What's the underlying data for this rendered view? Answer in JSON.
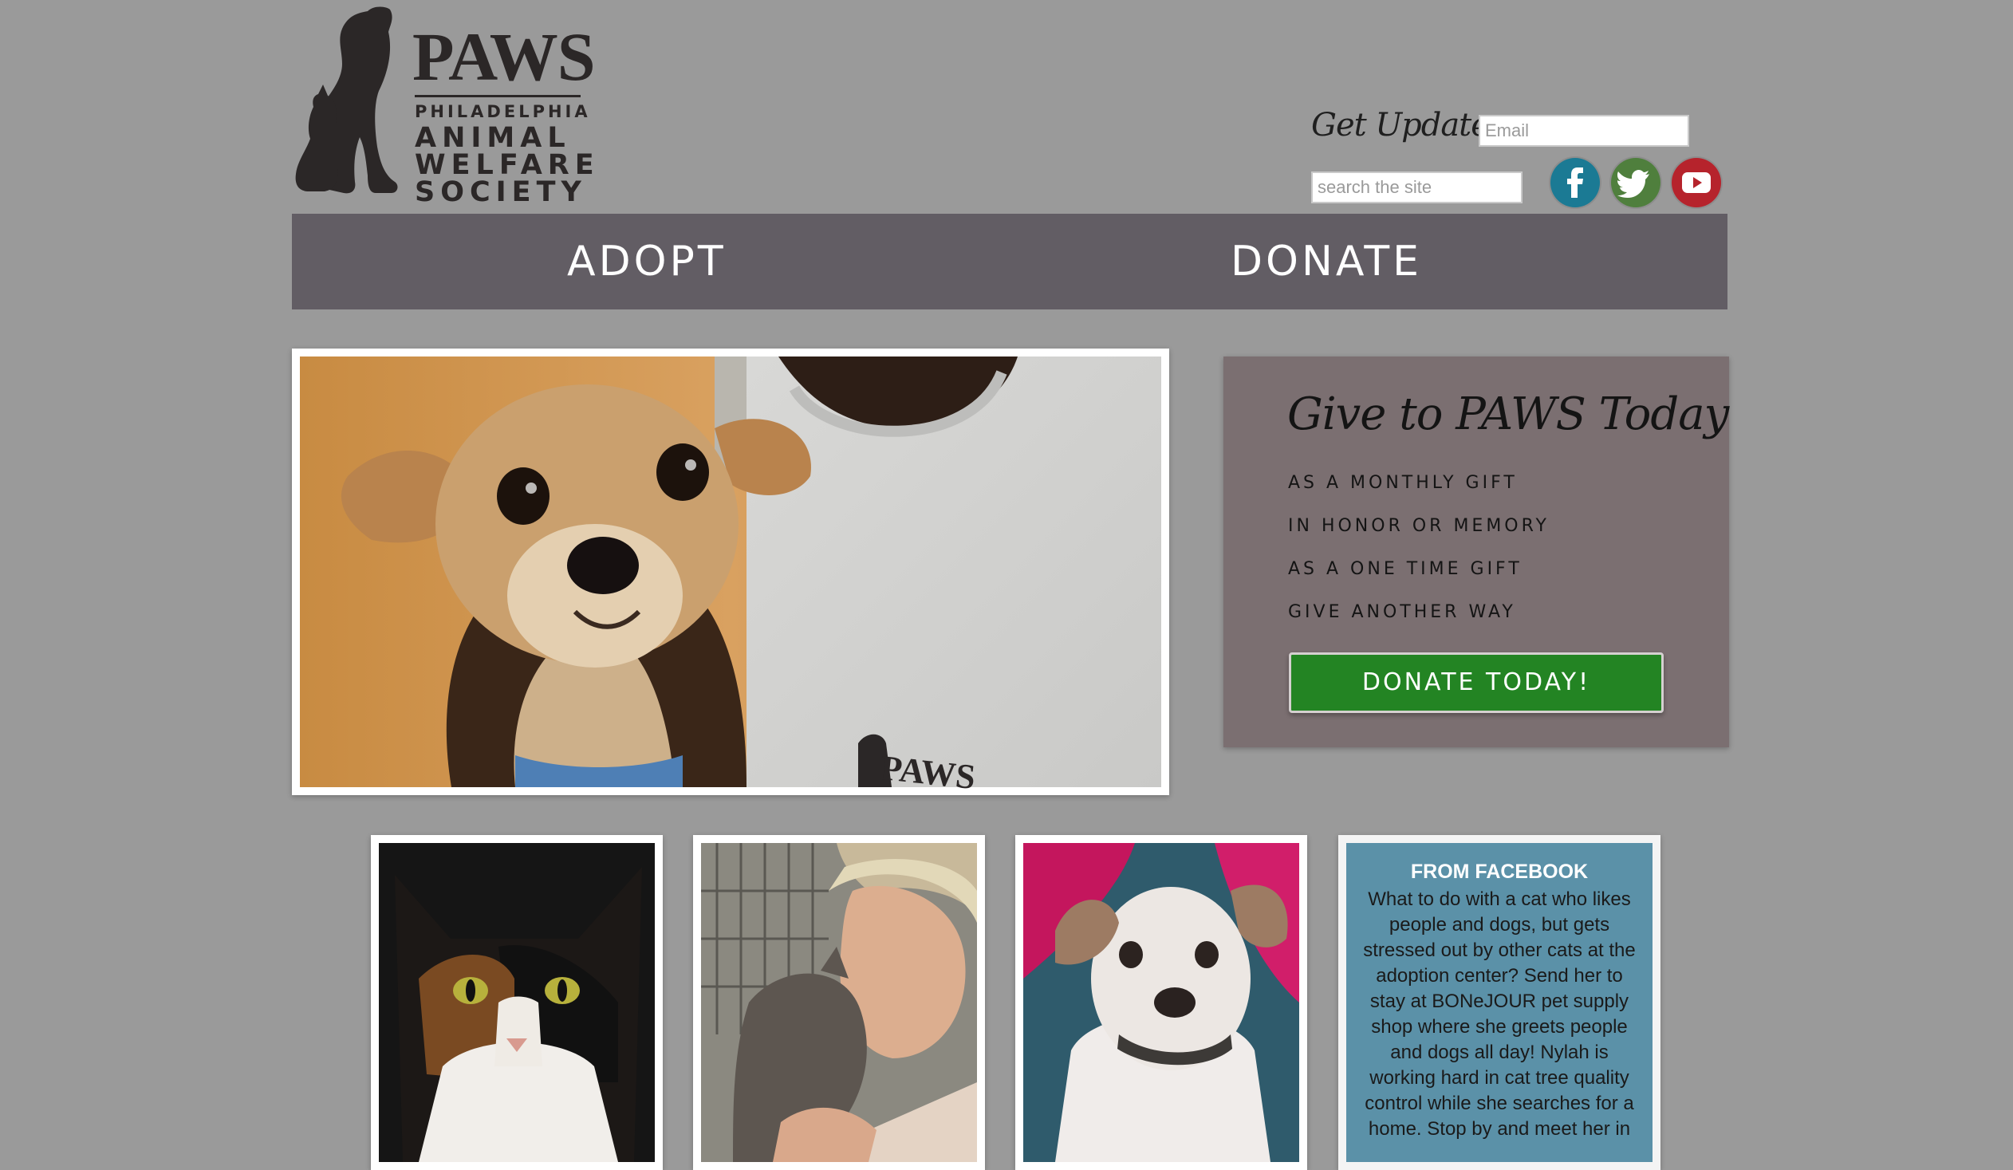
{
  "logo": {
    "name": "PAWS",
    "line1": "PHILADELPHIA",
    "line2": "ANIMAL",
    "line3": "WELFARE",
    "line4": "SOCIETY"
  },
  "header": {
    "get_updates_label": "Get Updates:",
    "email_placeholder": "Email",
    "search_placeholder": "search the site",
    "social": [
      {
        "name": "facebook",
        "icon": "facebook-icon",
        "color": "#1b7a94"
      },
      {
        "name": "twitter",
        "icon": "twitter-icon",
        "color": "#4f7f3d"
      },
      {
        "name": "youtube",
        "icon": "youtube-icon",
        "color": "#b6232c"
      }
    ]
  },
  "nav": {
    "items": [
      {
        "label": "ADOPT"
      },
      {
        "label": "DONATE"
      }
    ]
  },
  "hero": {
    "image": "dog-held-by-person-photo",
    "shirt_text": "PAWS"
  },
  "give": {
    "title": "Give to PAWS Today",
    "links": [
      {
        "label": "AS A MONTHLY GIFT"
      },
      {
        "label": "IN HONOR OR MEMORY"
      },
      {
        "label": "AS A ONE TIME GIFT"
      },
      {
        "label": "GIVE ANOTHER WAY"
      }
    ],
    "button_label": "DONATE TODAY!",
    "button_color": "#238423"
  },
  "tiles": [
    {
      "image": "calico-cat-photo"
    },
    {
      "image": "woman-with-kitten-photo"
    },
    {
      "image": "white-puppy-photo"
    }
  ],
  "facebook_tile": {
    "heading": "FROM FACEBOOK",
    "text": "What to do with a cat who likes people and dogs, but gets stressed out by other cats at the adoption center? Send her to stay at BONeJOUR pet supply shop where she greets people and dogs all day! Nylah is working hard in cat tree quality control while she searches for a home. Stop by and meet her in"
  },
  "colors": {
    "background": "#9a9a9a",
    "nav": "#625d64",
    "give_panel": "#7b6f71",
    "facebook_tile": "#5b91a8"
  }
}
